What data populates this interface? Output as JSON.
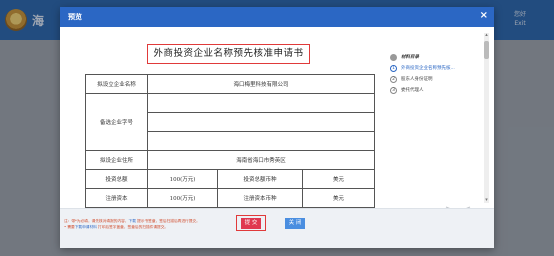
{
  "app": {
    "title": "海",
    "user_line1": "您好",
    "user_line2": "Exit"
  },
  "modal": {
    "title": "预览",
    "close_glyph": "×"
  },
  "document": {
    "title": "外商投资企业名称预先核准申请书",
    "rows": [
      {
        "label": "拟设立企业名称",
        "value": "海口梅里科技有限公司"
      },
      {
        "label": "备选企业字号",
        "values": [
          "",
          "",
          ""
        ]
      },
      {
        "label": "拟设企业住所",
        "value": "海南省海口市秀英区"
      }
    ],
    "investment": {
      "label": "投资总额",
      "amount": "100(万元)",
      "currency_label": "投资总额币种",
      "currency": "美元"
    },
    "capital": {
      "label": "注册资本",
      "amount": "100(万元)",
      "currency_label": "注册资本币种",
      "currency": "美元"
    }
  },
  "steps": [
    {
      "label": "材料目录",
      "state": "head"
    },
    {
      "num": "1",
      "label": "外商投资企业名称预先核...",
      "state": "active"
    },
    {
      "num": "2",
      "label": "股东人身份证明",
      "state": "normal"
    },
    {
      "num": "3",
      "label": "委托代理人",
      "state": "normal"
    }
  ],
  "footer": {
    "note1_a": "注：带*为必填，请先核对填报的内容，",
    "note1_link": "下载",
    "note1_b": " 提示书签章，签后扫描后再进行提交。",
    "note2_a": "• 需要",
    "note2_link": "下载申请材料",
    "note2_b": " 打印后签字盖章，签章后的扫描件请提交。",
    "submit_label": "提 交",
    "close_label": "关 闭"
  },
  "colors": {
    "header": "#2b67c4",
    "submit": "#e0374f",
    "close": "#4a8ee0",
    "highlight": "#e03a3a"
  }
}
